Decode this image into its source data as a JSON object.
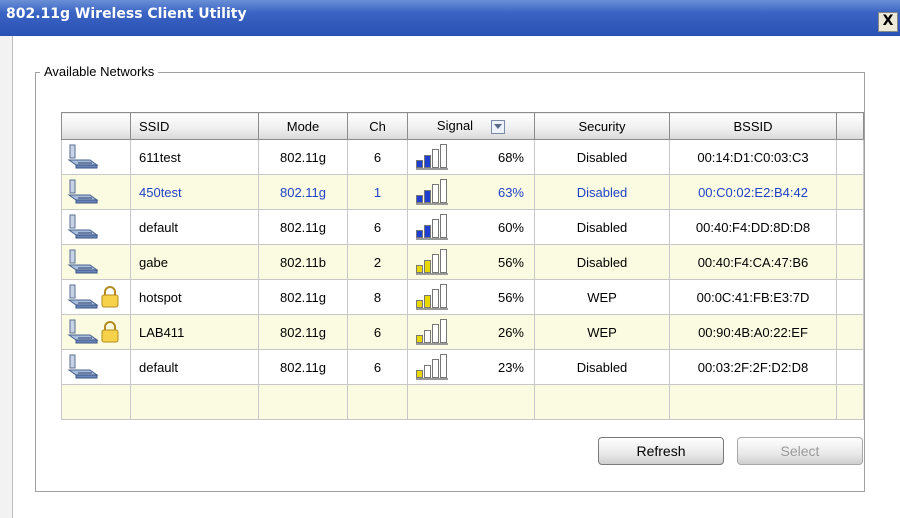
{
  "window": {
    "title": "802.11g Wireless Client Utility",
    "close_label": "X"
  },
  "group": {
    "legend": "Available Networks"
  },
  "table": {
    "headers": {
      "icon": "",
      "ssid": "SSID",
      "mode": "Mode",
      "ch": "Ch",
      "signal": "Signal",
      "security": "Security",
      "bssid": "BSSID"
    },
    "rows": [
      {
        "ssid": "611test",
        "mode": "802.11g",
        "ch": "6",
        "signal": "68%",
        "signal_level": 0.68,
        "security": "Disabled",
        "bssid": "00:14:D1:C0:03:C3",
        "locked": false
      },
      {
        "ssid": "450test",
        "mode": "802.11g",
        "ch": "1",
        "signal": "63%",
        "signal_level": 0.63,
        "security": "Disabled",
        "bssid": "00:C0:02:E2:B4:42",
        "locked": false,
        "selected": true
      },
      {
        "ssid": "default",
        "mode": "802.11g",
        "ch": "6",
        "signal": "60%",
        "signal_level": 0.6,
        "security": "Disabled",
        "bssid": "00:40:F4:DD:8D:D8",
        "locked": false
      },
      {
        "ssid": "gabe",
        "mode": "802.11b",
        "ch": "2",
        "signal": "56%",
        "signal_level": 0.56,
        "security": "Disabled",
        "bssid": "00:40:F4:CA:47:B6",
        "locked": false
      },
      {
        "ssid": "hotspot",
        "mode": "802.11g",
        "ch": "8",
        "signal": "56%",
        "signal_level": 0.56,
        "security": "WEP",
        "bssid": "00:0C:41:FB:E3:7D",
        "locked": true
      },
      {
        "ssid": "LAB411",
        "mode": "802.11g",
        "ch": "6",
        "signal": "26%",
        "signal_level": 0.26,
        "security": "WEP",
        "bssid": "00:90:4B:A0:22:EF",
        "locked": true
      },
      {
        "ssid": "default",
        "mode": "802.11g",
        "ch": "6",
        "signal": "23%",
        "signal_level": 0.23,
        "security": "Disabled",
        "bssid": "00:03:2F:2F:D2:D8",
        "locked": false
      }
    ]
  },
  "buttons": {
    "refresh": "Refresh",
    "select": "Select"
  },
  "colors": {
    "titlebar": "#2a50b4",
    "selected_text": "#2042c8",
    "row_alt": "#fbfbe1",
    "signal_strong": "#1f3fd0",
    "signal_weak": "#e8d800"
  },
  "icons": {
    "network": "computer-network-icon",
    "lock": "lock-icon",
    "sort": "sort-dropdown-icon",
    "close": "close-icon"
  }
}
